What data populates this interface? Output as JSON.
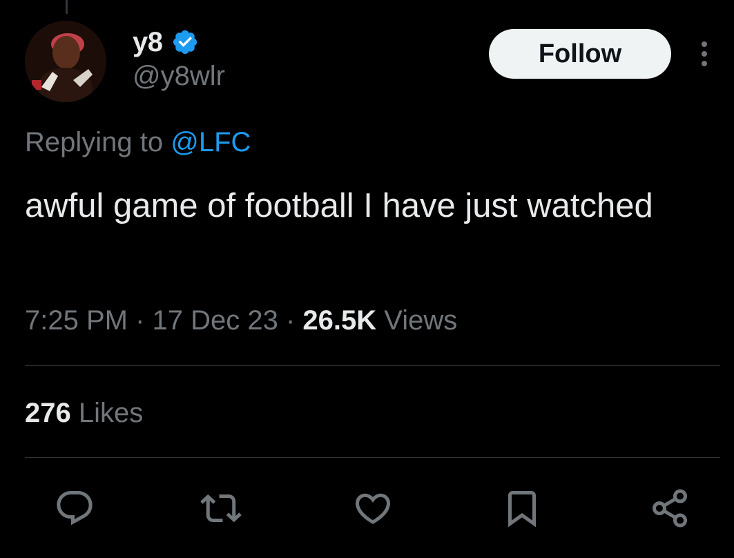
{
  "author": {
    "display_name": "y8",
    "handle": "@y8wlr",
    "verified": true,
    "verified_color": "#1d9bf0"
  },
  "follow_button": {
    "label": "Follow"
  },
  "reply_context": {
    "prefix": "Replying to ",
    "mention": "@LFC"
  },
  "tweet": {
    "text": "awful game of football I have just watched",
    "time": "7:25 PM",
    "date": "17 Dec 23",
    "separator": " · ",
    "views_count": "26.5K",
    "views_label": " Views"
  },
  "engagement": {
    "likes_count": "276",
    "likes_label": " Likes"
  },
  "actions": [
    {
      "icon": "reply-icon"
    },
    {
      "icon": "repost-icon"
    },
    {
      "icon": "like-icon"
    },
    {
      "icon": "bookmark-icon"
    },
    {
      "icon": "share-icon"
    }
  ],
  "colors": {
    "background": "#000000",
    "primary_text": "#e7e9ea",
    "secondary_text": "#71767b",
    "accent": "#1d9bf0",
    "divider": "#2f3336"
  }
}
